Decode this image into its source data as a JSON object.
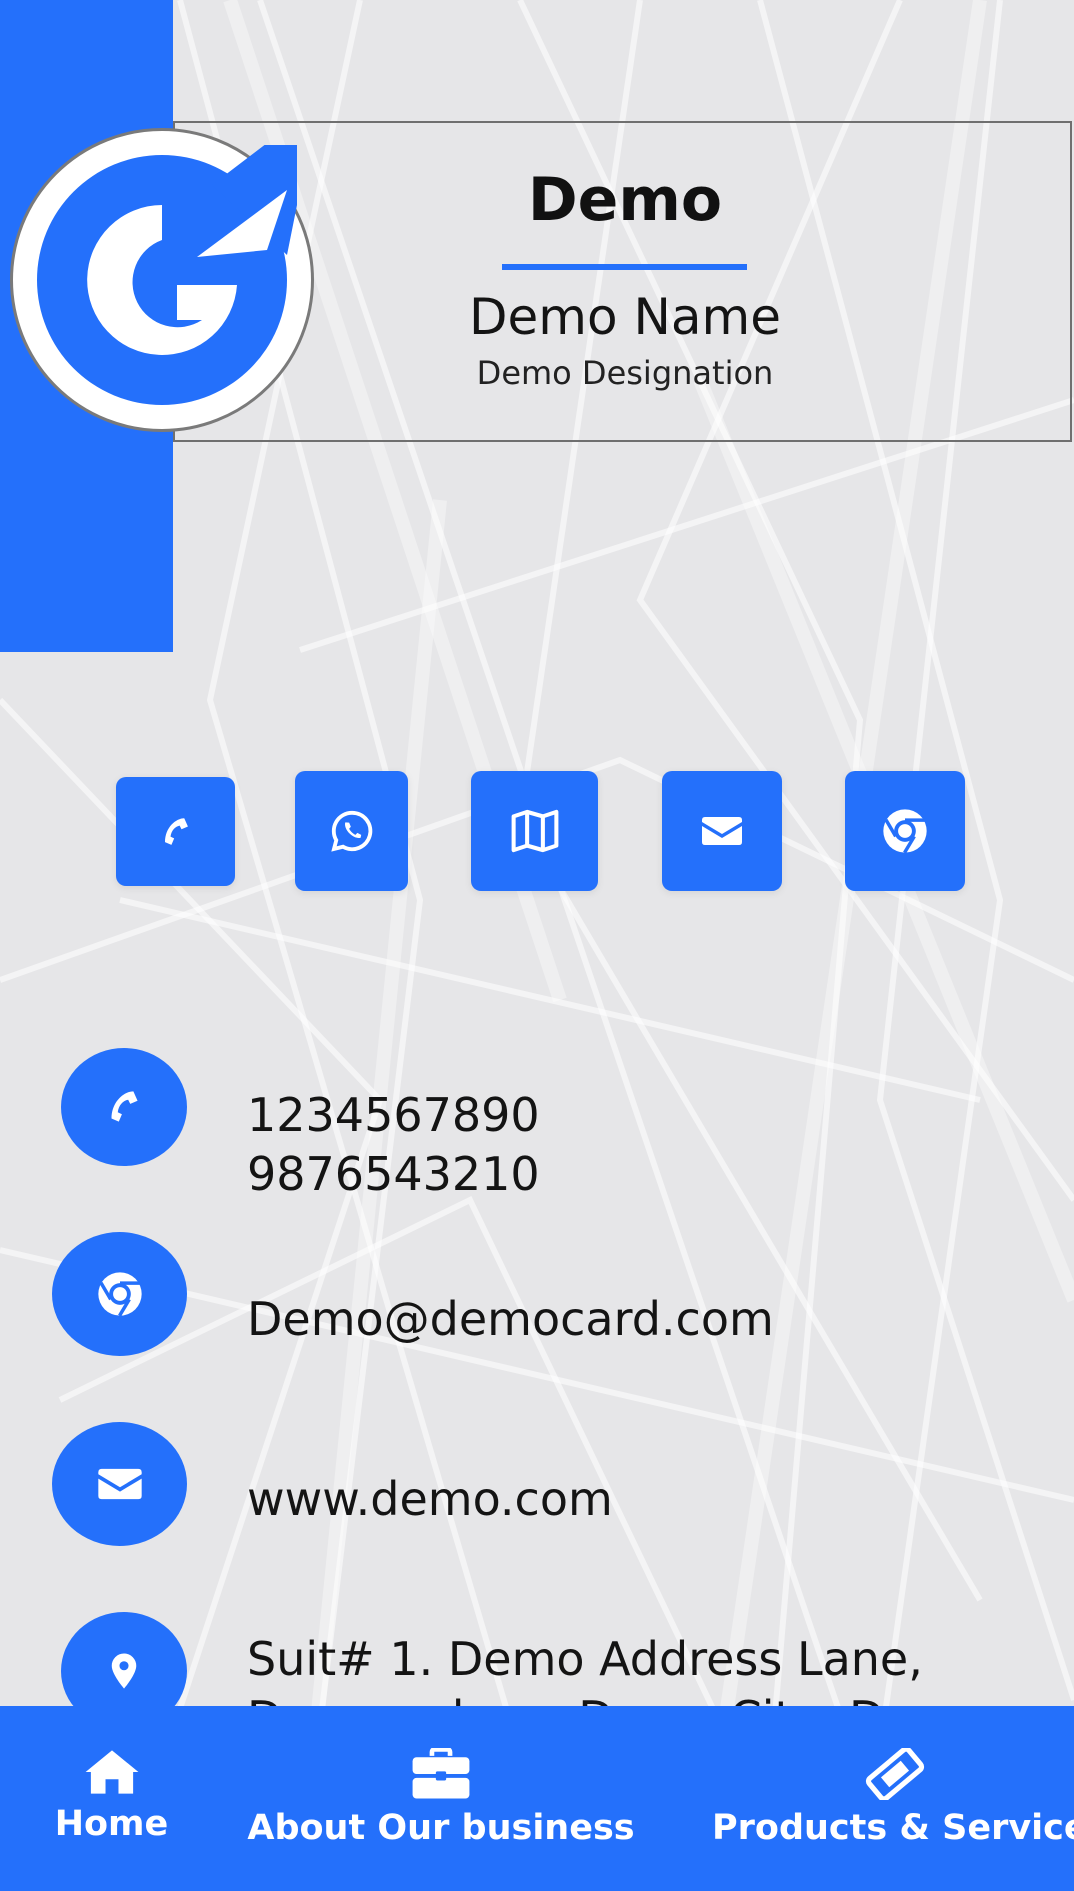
{
  "colors": {
    "accent": "#2470fb",
    "background": "#e6e6e8",
    "text": "#141414",
    "white": "#ffffff"
  },
  "header": {
    "logo_icon": "g-logo-icon",
    "company": "Demo",
    "person_name": "Demo Name",
    "designation": "Demo Designation"
  },
  "quick_actions": [
    {
      "icon": "phone-icon"
    },
    {
      "icon": "whatsapp-icon"
    },
    {
      "icon": "map-icon"
    },
    {
      "icon": "envelope-icon"
    },
    {
      "icon": "chrome-icon"
    }
  ],
  "contacts": {
    "phone": {
      "icon": "phone-icon",
      "line1": "1234567890",
      "line2": "9876543210"
    },
    "email": {
      "icon": "chrome-icon",
      "value": "Demo@democard.com"
    },
    "website": {
      "icon": "envelope-icon",
      "value": "www.demo.com"
    },
    "address": {
      "icon": "map-pin-icon",
      "line1": "Suit# 1. Demo Address Lane,",
      "line2": "Demo colony, Demo City, Demo"
    }
  },
  "bottom_nav": {
    "home": {
      "icon": "home-icon",
      "label": "Home"
    },
    "about": {
      "icon": "briefcase-icon",
      "label": "About Our business"
    },
    "products": {
      "icon": "ticket-icon",
      "label": "Products & Services"
    }
  }
}
